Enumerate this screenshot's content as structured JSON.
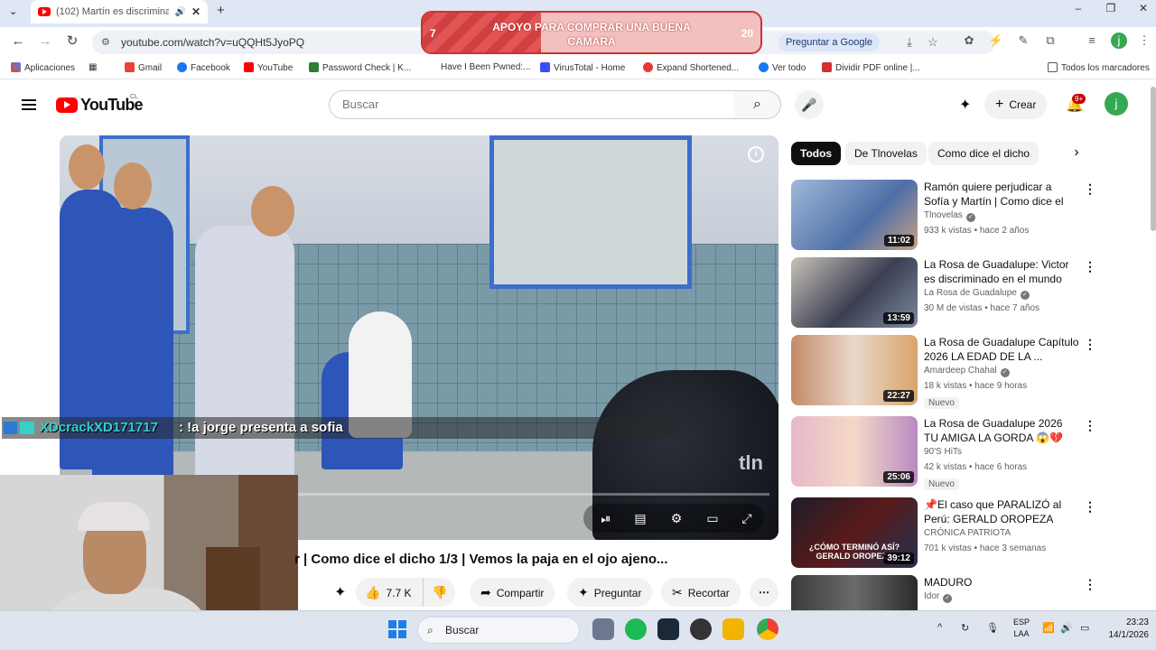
{
  "browser": {
    "tab_title": "(102) Martín es discriminad",
    "url": "youtube.com/watch?v=uQQHt5JyoPQ",
    "ask_google_label": "Preguntar a Google",
    "bookmarks": [
      {
        "label": "Aplicaciones"
      },
      {
        "label": "Gmail"
      },
      {
        "label": "Facebook"
      },
      {
        "label": "YouTube"
      },
      {
        "label": "Password Check | K..."
      },
      {
        "label": "Have I Been Pwned:..."
      },
      {
        "label": "VirusTotal - Home"
      },
      {
        "label": "Expand Shortened..."
      },
      {
        "label": "Ver todo"
      },
      {
        "label": "Dividir PDF online |..."
      }
    ],
    "all_bookmarks_label": "Todos los marcadores"
  },
  "overlay_goal": {
    "current": "7",
    "target": "20",
    "text": "APOYO PARA COMPRAR UNA BUENA CAMARA",
    "progress_fraction": 0.35
  },
  "youtube": {
    "logo_text": "YouTube",
    "country": "CL",
    "search_placeholder": "Buscar",
    "create_label": "Crear",
    "notifications_badge": "9+",
    "avatar_letter": "j"
  },
  "player": {
    "watermark": "tln",
    "progress_fraction": 0.3
  },
  "chat": {
    "user": "XDcrackXD171717",
    "message": ": !a jorge presenta a sofia"
  },
  "video": {
    "title": "r | Como dice el dicho 1/3 | Vemos la paja en el ojo ajeno...",
    "likes": "7.7 K",
    "share_label": "Compartir",
    "ask_label": "Preguntar",
    "clip_label": "Recortar"
  },
  "chips": [
    {
      "label": "Todos",
      "active": true
    },
    {
      "label": "De Tlnovelas"
    },
    {
      "label": "Como dice el dicho"
    }
  ],
  "recommendations": [
    {
      "title": "Ramón quiere perjudicar a Sofía y Martín | Como dice el dicho ...",
      "channel": "Tlnovelas",
      "meta": "933 k vistas • hace 2 años",
      "duration": "11:02",
      "nuevo": ""
    },
    {
      "title": "La Rosa de Guadalupe: Victor es discriminado en el mundo d...",
      "channel": "La Rosa de Guadalupe",
      "meta": "30 M de vistas • hace 7 años",
      "duration": "13:59",
      "nuevo": ""
    },
    {
      "title": "La Rosa de Guadalupe Capítulo 2026 LA EDAD DE LA ...",
      "channel": "Amardeep Chahal",
      "meta": "18 k vistas • hace 9 horas",
      "duration": "22:27",
      "nuevo": "Nuevo"
    },
    {
      "title": "La Rosa de Guadalupe 2026  TU AMIGA LA GORDA 😱💔  Part...",
      "channel": "90'S HiTs",
      "meta": "42 k vistas • hace 6 horas",
      "duration": "25:06",
      "nuevo": "Nuevo"
    },
    {
      "title": "📌El caso que PARALIZÓ al Perú: GERALD OROPEZA",
      "channel": "CRÓNICA PATRIOTA",
      "meta": "701 k vistas • hace 3 semanas",
      "duration": "39:12",
      "nuevo": "",
      "thumb_text": "¿CÓMO TERMINÓ ASÍ? GERALD OROPEZA"
    },
    {
      "title": "MADURO",
      "channel": "Idor",
      "meta": "",
      "duration": "",
      "nuevo": ""
    }
  ],
  "taskbar": {
    "search_label": "Buscar",
    "lang_line1": "ESP",
    "lang_line2": "LAA",
    "time": "23:23",
    "date": "14/1/2026"
  },
  "colors": {
    "youtube_red": "#ff0000",
    "goal_red": "#d04040",
    "chat_user": "#35d0c8"
  }
}
